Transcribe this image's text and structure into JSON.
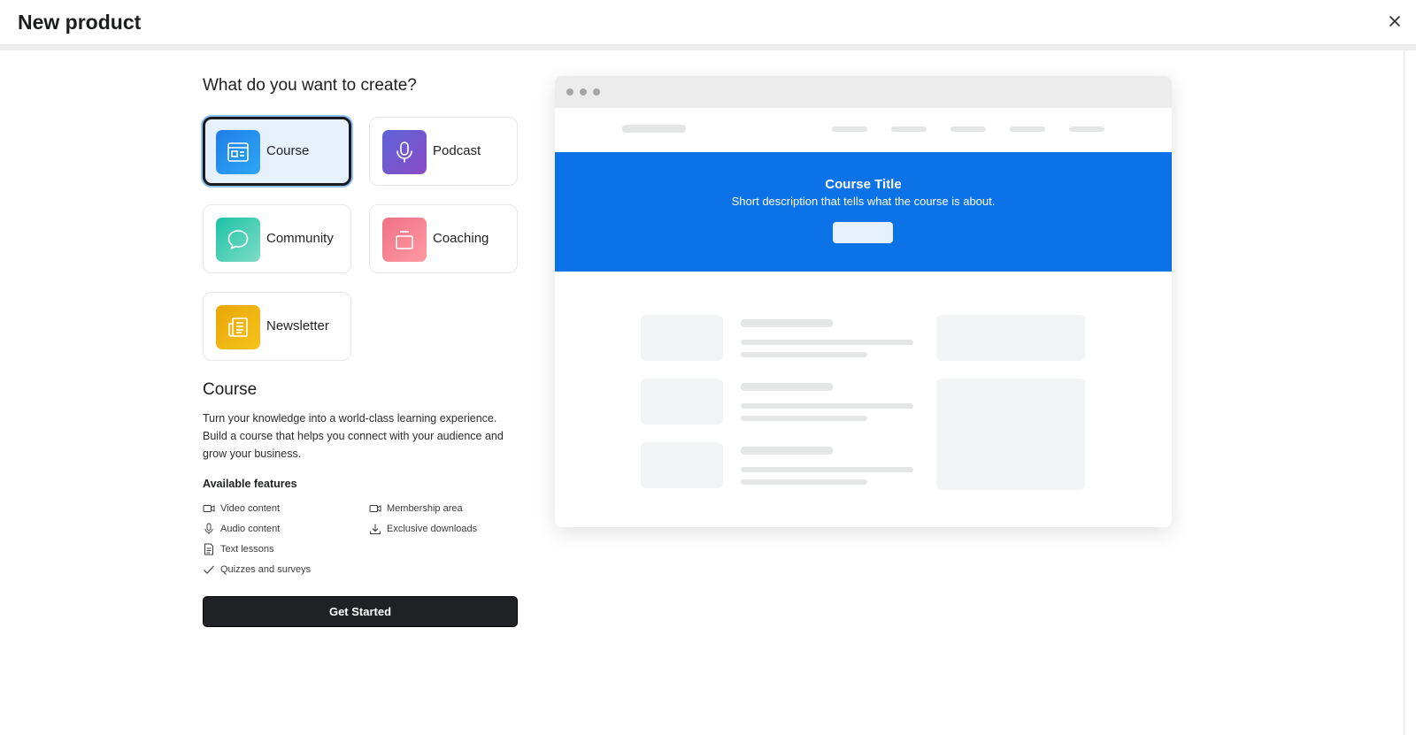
{
  "header": {
    "title": "New product",
    "close_icon": "close-icon"
  },
  "chooser": {
    "question": "What do you want to create?",
    "options": [
      {
        "label": "Course",
        "icon": "course-icon",
        "gradient": [
          "#1e7ee8",
          "#2fa6f3"
        ],
        "selected": true
      },
      {
        "label": "Podcast",
        "icon": "microphone-icon",
        "gradient": [
          "#5d63d6",
          "#8a4cc6"
        ],
        "selected": false
      },
      {
        "label": "Community",
        "icon": "chat-bubble-icon",
        "gradient": [
          "#1cc2a6",
          "#7fdcc6"
        ],
        "selected": false
      },
      {
        "label": "Coaching",
        "icon": "coaching-icon",
        "gradient": [
          "#f07084",
          "#ff9aa3"
        ],
        "selected": false
      },
      {
        "label": "Newsletter",
        "icon": "newspaper-icon",
        "gradient": [
          "#e8a707",
          "#f7c31c"
        ],
        "selected": false
      }
    ]
  },
  "detail": {
    "title": "Course",
    "description": "Turn your knowledge into a world-class learning experience. Build a course that helps you connect with your audience and grow your business.",
    "features_title": "Available features",
    "features": [
      {
        "label": "Video content",
        "icon": "video-icon"
      },
      {
        "label": "Audio content",
        "icon": "microphone-icon"
      },
      {
        "label": "Text lessons",
        "icon": "document-icon"
      },
      {
        "label": "Quizzes and surveys",
        "icon": "check-icon"
      },
      {
        "label": "Membership area",
        "icon": "video-icon"
      },
      {
        "label": "Exclusive downloads",
        "icon": "download-icon"
      }
    ],
    "cta_label": "Get Started"
  },
  "preview": {
    "hero_title": "Course Title",
    "hero_subtitle": "Short description that tells what the course is about.",
    "hero_color": "#0b72e7"
  }
}
